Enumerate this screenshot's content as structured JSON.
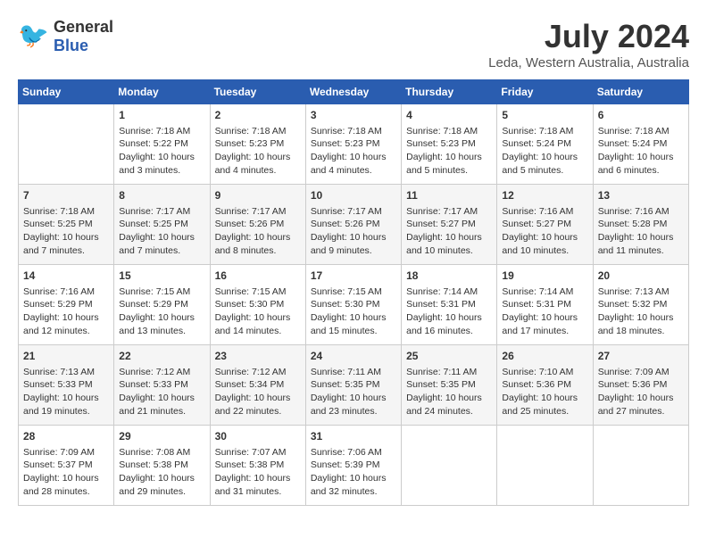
{
  "logo": {
    "general": "General",
    "blue": "Blue"
  },
  "title": "July 2024",
  "subtitle": "Leda, Western Australia, Australia",
  "days_header": [
    "Sunday",
    "Monday",
    "Tuesday",
    "Wednesday",
    "Thursday",
    "Friday",
    "Saturday"
  ],
  "weeks": [
    [
      {
        "day": "",
        "info": ""
      },
      {
        "day": "1",
        "info": "Sunrise: 7:18 AM\nSunset: 5:22 PM\nDaylight: 10 hours\nand 3 minutes."
      },
      {
        "day": "2",
        "info": "Sunrise: 7:18 AM\nSunset: 5:23 PM\nDaylight: 10 hours\nand 4 minutes."
      },
      {
        "day": "3",
        "info": "Sunrise: 7:18 AM\nSunset: 5:23 PM\nDaylight: 10 hours\nand 4 minutes."
      },
      {
        "day": "4",
        "info": "Sunrise: 7:18 AM\nSunset: 5:23 PM\nDaylight: 10 hours\nand 5 minutes."
      },
      {
        "day": "5",
        "info": "Sunrise: 7:18 AM\nSunset: 5:24 PM\nDaylight: 10 hours\nand 5 minutes."
      },
      {
        "day": "6",
        "info": "Sunrise: 7:18 AM\nSunset: 5:24 PM\nDaylight: 10 hours\nand 6 minutes."
      }
    ],
    [
      {
        "day": "7",
        "info": "Sunrise: 7:18 AM\nSunset: 5:25 PM\nDaylight: 10 hours\nand 7 minutes."
      },
      {
        "day": "8",
        "info": "Sunrise: 7:17 AM\nSunset: 5:25 PM\nDaylight: 10 hours\nand 7 minutes."
      },
      {
        "day": "9",
        "info": "Sunrise: 7:17 AM\nSunset: 5:26 PM\nDaylight: 10 hours\nand 8 minutes."
      },
      {
        "day": "10",
        "info": "Sunrise: 7:17 AM\nSunset: 5:26 PM\nDaylight: 10 hours\nand 9 minutes."
      },
      {
        "day": "11",
        "info": "Sunrise: 7:17 AM\nSunset: 5:27 PM\nDaylight: 10 hours\nand 10 minutes."
      },
      {
        "day": "12",
        "info": "Sunrise: 7:16 AM\nSunset: 5:27 PM\nDaylight: 10 hours\nand 10 minutes."
      },
      {
        "day": "13",
        "info": "Sunrise: 7:16 AM\nSunset: 5:28 PM\nDaylight: 10 hours\nand 11 minutes."
      }
    ],
    [
      {
        "day": "14",
        "info": "Sunrise: 7:16 AM\nSunset: 5:29 PM\nDaylight: 10 hours\nand 12 minutes."
      },
      {
        "day": "15",
        "info": "Sunrise: 7:15 AM\nSunset: 5:29 PM\nDaylight: 10 hours\nand 13 minutes."
      },
      {
        "day": "16",
        "info": "Sunrise: 7:15 AM\nSunset: 5:30 PM\nDaylight: 10 hours\nand 14 minutes."
      },
      {
        "day": "17",
        "info": "Sunrise: 7:15 AM\nSunset: 5:30 PM\nDaylight: 10 hours\nand 15 minutes."
      },
      {
        "day": "18",
        "info": "Sunrise: 7:14 AM\nSunset: 5:31 PM\nDaylight: 10 hours\nand 16 minutes."
      },
      {
        "day": "19",
        "info": "Sunrise: 7:14 AM\nSunset: 5:31 PM\nDaylight: 10 hours\nand 17 minutes."
      },
      {
        "day": "20",
        "info": "Sunrise: 7:13 AM\nSunset: 5:32 PM\nDaylight: 10 hours\nand 18 minutes."
      }
    ],
    [
      {
        "day": "21",
        "info": "Sunrise: 7:13 AM\nSunset: 5:33 PM\nDaylight: 10 hours\nand 19 minutes."
      },
      {
        "day": "22",
        "info": "Sunrise: 7:12 AM\nSunset: 5:33 PM\nDaylight: 10 hours\nand 21 minutes."
      },
      {
        "day": "23",
        "info": "Sunrise: 7:12 AM\nSunset: 5:34 PM\nDaylight: 10 hours\nand 22 minutes."
      },
      {
        "day": "24",
        "info": "Sunrise: 7:11 AM\nSunset: 5:35 PM\nDaylight: 10 hours\nand 23 minutes."
      },
      {
        "day": "25",
        "info": "Sunrise: 7:11 AM\nSunset: 5:35 PM\nDaylight: 10 hours\nand 24 minutes."
      },
      {
        "day": "26",
        "info": "Sunrise: 7:10 AM\nSunset: 5:36 PM\nDaylight: 10 hours\nand 25 minutes."
      },
      {
        "day": "27",
        "info": "Sunrise: 7:09 AM\nSunset: 5:36 PM\nDaylight: 10 hours\nand 27 minutes."
      }
    ],
    [
      {
        "day": "28",
        "info": "Sunrise: 7:09 AM\nSunset: 5:37 PM\nDaylight: 10 hours\nand 28 minutes."
      },
      {
        "day": "29",
        "info": "Sunrise: 7:08 AM\nSunset: 5:38 PM\nDaylight: 10 hours\nand 29 minutes."
      },
      {
        "day": "30",
        "info": "Sunrise: 7:07 AM\nSunset: 5:38 PM\nDaylight: 10 hours\nand 31 minutes."
      },
      {
        "day": "31",
        "info": "Sunrise: 7:06 AM\nSunset: 5:39 PM\nDaylight: 10 hours\nand 32 minutes."
      },
      {
        "day": "",
        "info": ""
      },
      {
        "day": "",
        "info": ""
      },
      {
        "day": "",
        "info": ""
      }
    ]
  ]
}
